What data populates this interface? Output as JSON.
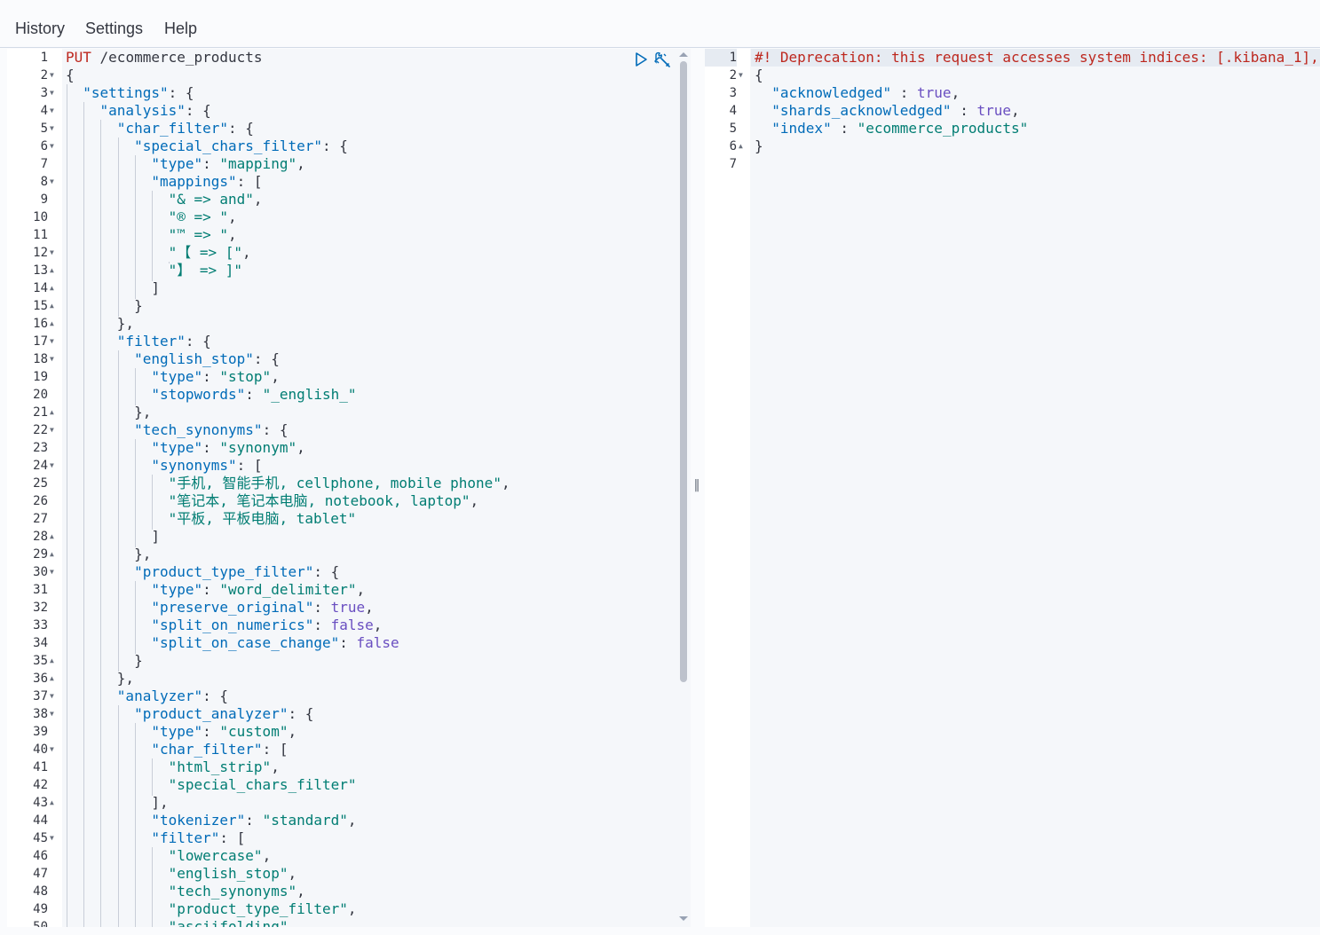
{
  "menu": {
    "history": "History",
    "settings": "Settings",
    "help": "Help"
  },
  "request": {
    "method": "PUT",
    "path": "/ecommerce_products",
    "lines": [
      {
        "n": "1",
        "fold": "",
        "tokens": [
          {
            "t": "method",
            "v": "PUT"
          },
          {
            "t": "url",
            "v": " /ecommerce_products"
          }
        ]
      },
      {
        "n": "2",
        "fold": "▼",
        "tokens": [
          {
            "t": "punc",
            "v": "{"
          }
        ]
      },
      {
        "n": "3",
        "fold": "▼",
        "tokens": [
          {
            "t": "punc",
            "v": "  "
          },
          {
            "t": "key",
            "v": "\"settings\""
          },
          {
            "t": "punc",
            "v": ": {"
          }
        ]
      },
      {
        "n": "4",
        "fold": "▼",
        "tokens": [
          {
            "t": "punc",
            "v": "    "
          },
          {
            "t": "key",
            "v": "\"analysis\""
          },
          {
            "t": "punc",
            "v": ": {"
          }
        ]
      },
      {
        "n": "5",
        "fold": "▼",
        "tokens": [
          {
            "t": "punc",
            "v": "      "
          },
          {
            "t": "key",
            "v": "\"char_filter\""
          },
          {
            "t": "punc",
            "v": ": {"
          }
        ]
      },
      {
        "n": "6",
        "fold": "▼",
        "tokens": [
          {
            "t": "punc",
            "v": "        "
          },
          {
            "t": "key",
            "v": "\"special_chars_filter\""
          },
          {
            "t": "punc",
            "v": ": {"
          }
        ]
      },
      {
        "n": "7",
        "fold": "",
        "tokens": [
          {
            "t": "punc",
            "v": "          "
          },
          {
            "t": "key",
            "v": "\"type\""
          },
          {
            "t": "punc",
            "v": ": "
          },
          {
            "t": "str",
            "v": "\"mapping\""
          },
          {
            "t": "punc",
            "v": ","
          }
        ]
      },
      {
        "n": "8",
        "fold": "▼",
        "tokens": [
          {
            "t": "punc",
            "v": "          "
          },
          {
            "t": "key",
            "v": "\"mappings\""
          },
          {
            "t": "punc",
            "v": ": ["
          }
        ]
      },
      {
        "n": "9",
        "fold": "",
        "tokens": [
          {
            "t": "punc",
            "v": "            "
          },
          {
            "t": "str",
            "v": "\"& => and\""
          },
          {
            "t": "punc",
            "v": ","
          }
        ]
      },
      {
        "n": "10",
        "fold": "",
        "tokens": [
          {
            "t": "punc",
            "v": "            "
          },
          {
            "t": "str",
            "v": "\"® => \""
          },
          {
            "t": "punc",
            "v": ","
          }
        ]
      },
      {
        "n": "11",
        "fold": "",
        "tokens": [
          {
            "t": "punc",
            "v": "            "
          },
          {
            "t": "str",
            "v": "\"™ => \""
          },
          {
            "t": "punc",
            "v": ","
          }
        ]
      },
      {
        "n": "12",
        "fold": "▼",
        "tokens": [
          {
            "t": "punc",
            "v": "            "
          },
          {
            "t": "str",
            "v": "\"【 => [\""
          },
          {
            "t": "punc",
            "v": ","
          }
        ]
      },
      {
        "n": "13",
        "fold": "▲",
        "tokens": [
          {
            "t": "punc",
            "v": "            "
          },
          {
            "t": "str",
            "v": "\"】 => ]\""
          }
        ]
      },
      {
        "n": "14",
        "fold": "▲",
        "tokens": [
          {
            "t": "punc",
            "v": "          ]"
          }
        ]
      },
      {
        "n": "15",
        "fold": "▲",
        "tokens": [
          {
            "t": "punc",
            "v": "        }"
          }
        ]
      },
      {
        "n": "16",
        "fold": "▲",
        "tokens": [
          {
            "t": "punc",
            "v": "      },"
          }
        ]
      },
      {
        "n": "17",
        "fold": "▼",
        "tokens": [
          {
            "t": "punc",
            "v": "      "
          },
          {
            "t": "key",
            "v": "\"filter\""
          },
          {
            "t": "punc",
            "v": ": {"
          }
        ]
      },
      {
        "n": "18",
        "fold": "▼",
        "tokens": [
          {
            "t": "punc",
            "v": "        "
          },
          {
            "t": "key",
            "v": "\"english_stop\""
          },
          {
            "t": "punc",
            "v": ": {"
          }
        ]
      },
      {
        "n": "19",
        "fold": "",
        "tokens": [
          {
            "t": "punc",
            "v": "          "
          },
          {
            "t": "key",
            "v": "\"type\""
          },
          {
            "t": "punc",
            "v": ": "
          },
          {
            "t": "str",
            "v": "\"stop\""
          },
          {
            "t": "punc",
            "v": ","
          }
        ]
      },
      {
        "n": "20",
        "fold": "",
        "tokens": [
          {
            "t": "punc",
            "v": "          "
          },
          {
            "t": "key",
            "v": "\"stopwords\""
          },
          {
            "t": "punc",
            "v": ": "
          },
          {
            "t": "str",
            "v": "\"_english_\""
          }
        ]
      },
      {
        "n": "21",
        "fold": "▲",
        "tokens": [
          {
            "t": "punc",
            "v": "        },"
          }
        ]
      },
      {
        "n": "22",
        "fold": "▼",
        "tokens": [
          {
            "t": "punc",
            "v": "        "
          },
          {
            "t": "key",
            "v": "\"tech_synonyms\""
          },
          {
            "t": "punc",
            "v": ": {"
          }
        ]
      },
      {
        "n": "23",
        "fold": "",
        "tokens": [
          {
            "t": "punc",
            "v": "          "
          },
          {
            "t": "key",
            "v": "\"type\""
          },
          {
            "t": "punc",
            "v": ": "
          },
          {
            "t": "str",
            "v": "\"synonym\""
          },
          {
            "t": "punc",
            "v": ","
          }
        ]
      },
      {
        "n": "24",
        "fold": "▼",
        "tokens": [
          {
            "t": "punc",
            "v": "          "
          },
          {
            "t": "key",
            "v": "\"synonyms\""
          },
          {
            "t": "punc",
            "v": ": ["
          }
        ]
      },
      {
        "n": "25",
        "fold": "",
        "tokens": [
          {
            "t": "punc",
            "v": "            "
          },
          {
            "t": "str",
            "v": "\"手机, 智能手机, cellphone, mobile phone\""
          },
          {
            "t": "punc",
            "v": ","
          }
        ]
      },
      {
        "n": "26",
        "fold": "",
        "tokens": [
          {
            "t": "punc",
            "v": "            "
          },
          {
            "t": "str",
            "v": "\"笔记本, 笔记本电脑, notebook, laptop\""
          },
          {
            "t": "punc",
            "v": ","
          }
        ]
      },
      {
        "n": "27",
        "fold": "",
        "tokens": [
          {
            "t": "punc",
            "v": "            "
          },
          {
            "t": "str",
            "v": "\"平板, 平板电脑, tablet\""
          }
        ]
      },
      {
        "n": "28",
        "fold": "▲",
        "tokens": [
          {
            "t": "punc",
            "v": "          ]"
          }
        ]
      },
      {
        "n": "29",
        "fold": "▲",
        "tokens": [
          {
            "t": "punc",
            "v": "        },"
          }
        ]
      },
      {
        "n": "30",
        "fold": "▼",
        "tokens": [
          {
            "t": "punc",
            "v": "        "
          },
          {
            "t": "key",
            "v": "\"product_type_filter\""
          },
          {
            "t": "punc",
            "v": ": {"
          }
        ]
      },
      {
        "n": "31",
        "fold": "",
        "tokens": [
          {
            "t": "punc",
            "v": "          "
          },
          {
            "t": "key",
            "v": "\"type\""
          },
          {
            "t": "punc",
            "v": ": "
          },
          {
            "t": "str",
            "v": "\"word_delimiter\""
          },
          {
            "t": "punc",
            "v": ","
          }
        ]
      },
      {
        "n": "32",
        "fold": "",
        "tokens": [
          {
            "t": "punc",
            "v": "          "
          },
          {
            "t": "key",
            "v": "\"preserve_original\""
          },
          {
            "t": "punc",
            "v": ": "
          },
          {
            "t": "bool",
            "v": "true"
          },
          {
            "t": "punc",
            "v": ","
          }
        ]
      },
      {
        "n": "33",
        "fold": "",
        "tokens": [
          {
            "t": "punc",
            "v": "          "
          },
          {
            "t": "key",
            "v": "\"split_on_numerics\""
          },
          {
            "t": "punc",
            "v": ": "
          },
          {
            "t": "bool",
            "v": "false"
          },
          {
            "t": "punc",
            "v": ","
          }
        ]
      },
      {
        "n": "34",
        "fold": "",
        "tokens": [
          {
            "t": "punc",
            "v": "          "
          },
          {
            "t": "key",
            "v": "\"split_on_case_change\""
          },
          {
            "t": "punc",
            "v": ": "
          },
          {
            "t": "bool",
            "v": "false"
          }
        ]
      },
      {
        "n": "35",
        "fold": "▲",
        "tokens": [
          {
            "t": "punc",
            "v": "        }"
          }
        ]
      },
      {
        "n": "36",
        "fold": "▲",
        "tokens": [
          {
            "t": "punc",
            "v": "      },"
          }
        ]
      },
      {
        "n": "37",
        "fold": "▼",
        "tokens": [
          {
            "t": "punc",
            "v": "      "
          },
          {
            "t": "key",
            "v": "\"analyzer\""
          },
          {
            "t": "punc",
            "v": ": {"
          }
        ]
      },
      {
        "n": "38",
        "fold": "▼",
        "tokens": [
          {
            "t": "punc",
            "v": "        "
          },
          {
            "t": "key",
            "v": "\"product_analyzer\""
          },
          {
            "t": "punc",
            "v": ": {"
          }
        ]
      },
      {
        "n": "39",
        "fold": "",
        "tokens": [
          {
            "t": "punc",
            "v": "          "
          },
          {
            "t": "key",
            "v": "\"type\""
          },
          {
            "t": "punc",
            "v": ": "
          },
          {
            "t": "str",
            "v": "\"custom\""
          },
          {
            "t": "punc",
            "v": ","
          }
        ]
      },
      {
        "n": "40",
        "fold": "▼",
        "tokens": [
          {
            "t": "punc",
            "v": "          "
          },
          {
            "t": "key",
            "v": "\"char_filter\""
          },
          {
            "t": "punc",
            "v": ": ["
          }
        ]
      },
      {
        "n": "41",
        "fold": "",
        "tokens": [
          {
            "t": "punc",
            "v": "            "
          },
          {
            "t": "str",
            "v": "\"html_strip\""
          },
          {
            "t": "punc",
            "v": ","
          }
        ]
      },
      {
        "n": "42",
        "fold": "",
        "tokens": [
          {
            "t": "punc",
            "v": "            "
          },
          {
            "t": "str",
            "v": "\"special_chars_filter\""
          }
        ]
      },
      {
        "n": "43",
        "fold": "▲",
        "tokens": [
          {
            "t": "punc",
            "v": "          ],"
          }
        ]
      },
      {
        "n": "44",
        "fold": "",
        "tokens": [
          {
            "t": "punc",
            "v": "          "
          },
          {
            "t": "key",
            "v": "\"tokenizer\""
          },
          {
            "t": "punc",
            "v": ": "
          },
          {
            "t": "str",
            "v": "\"standard\""
          },
          {
            "t": "punc",
            "v": ","
          }
        ]
      },
      {
        "n": "45",
        "fold": "▼",
        "tokens": [
          {
            "t": "punc",
            "v": "          "
          },
          {
            "t": "key",
            "v": "\"filter\""
          },
          {
            "t": "punc",
            "v": ": ["
          }
        ]
      },
      {
        "n": "46",
        "fold": "",
        "tokens": [
          {
            "t": "punc",
            "v": "            "
          },
          {
            "t": "str",
            "v": "\"lowercase\""
          },
          {
            "t": "punc",
            "v": ","
          }
        ]
      },
      {
        "n": "47",
        "fold": "",
        "tokens": [
          {
            "t": "punc",
            "v": "            "
          },
          {
            "t": "str",
            "v": "\"english_stop\""
          },
          {
            "t": "punc",
            "v": ","
          }
        ]
      },
      {
        "n": "48",
        "fold": "",
        "tokens": [
          {
            "t": "punc",
            "v": "            "
          },
          {
            "t": "str",
            "v": "\"tech_synonyms\""
          },
          {
            "t": "punc",
            "v": ","
          }
        ]
      },
      {
        "n": "49",
        "fold": "",
        "tokens": [
          {
            "t": "punc",
            "v": "            "
          },
          {
            "t": "str",
            "v": "\"product_type_filter\""
          },
          {
            "t": "punc",
            "v": ","
          }
        ]
      },
      {
        "n": "50",
        "fold": "",
        "tokens": [
          {
            "t": "punc",
            "v": "            "
          },
          {
            "t": "str",
            "v": "\"asciifolding\""
          }
        ]
      }
    ]
  },
  "response": {
    "lines": [
      {
        "n": "1",
        "fold": "",
        "tokens": [
          {
            "t": "warn",
            "v": "#! Deprecation: this request accesses system indices: [.kibana_1],"
          }
        ]
      },
      {
        "n": "2",
        "fold": "▼",
        "tokens": [
          {
            "t": "punc",
            "v": "{"
          }
        ]
      },
      {
        "n": "3",
        "fold": "",
        "tokens": [
          {
            "t": "punc",
            "v": "  "
          },
          {
            "t": "key",
            "v": "\"acknowledged\""
          },
          {
            "t": "punc",
            "v": " : "
          },
          {
            "t": "bool",
            "v": "true"
          },
          {
            "t": "punc",
            "v": ","
          }
        ]
      },
      {
        "n": "4",
        "fold": "",
        "tokens": [
          {
            "t": "punc",
            "v": "  "
          },
          {
            "t": "key",
            "v": "\"shards_acknowledged\""
          },
          {
            "t": "punc",
            "v": " : "
          },
          {
            "t": "bool",
            "v": "true"
          },
          {
            "t": "punc",
            "v": ","
          }
        ]
      },
      {
        "n": "5",
        "fold": "",
        "tokens": [
          {
            "t": "punc",
            "v": "  "
          },
          {
            "t": "key",
            "v": "\"index\""
          },
          {
            "t": "punc",
            "v": " : "
          },
          {
            "t": "str",
            "v": "\"ecommerce_products\""
          }
        ]
      },
      {
        "n": "6",
        "fold": "▲",
        "tokens": [
          {
            "t": "punc",
            "v": "}"
          }
        ]
      },
      {
        "n": "7",
        "fold": "",
        "tokens": []
      }
    ]
  },
  "actions": {
    "run_icon": "play-icon",
    "settings_icon": "wrench-icon"
  },
  "colors": {
    "key": "#006bb8",
    "string": "#017d73",
    "boolean": "#6a4fc1",
    "method": "#bd271e",
    "warning": "#bd271e",
    "accent": "#006bb8"
  }
}
